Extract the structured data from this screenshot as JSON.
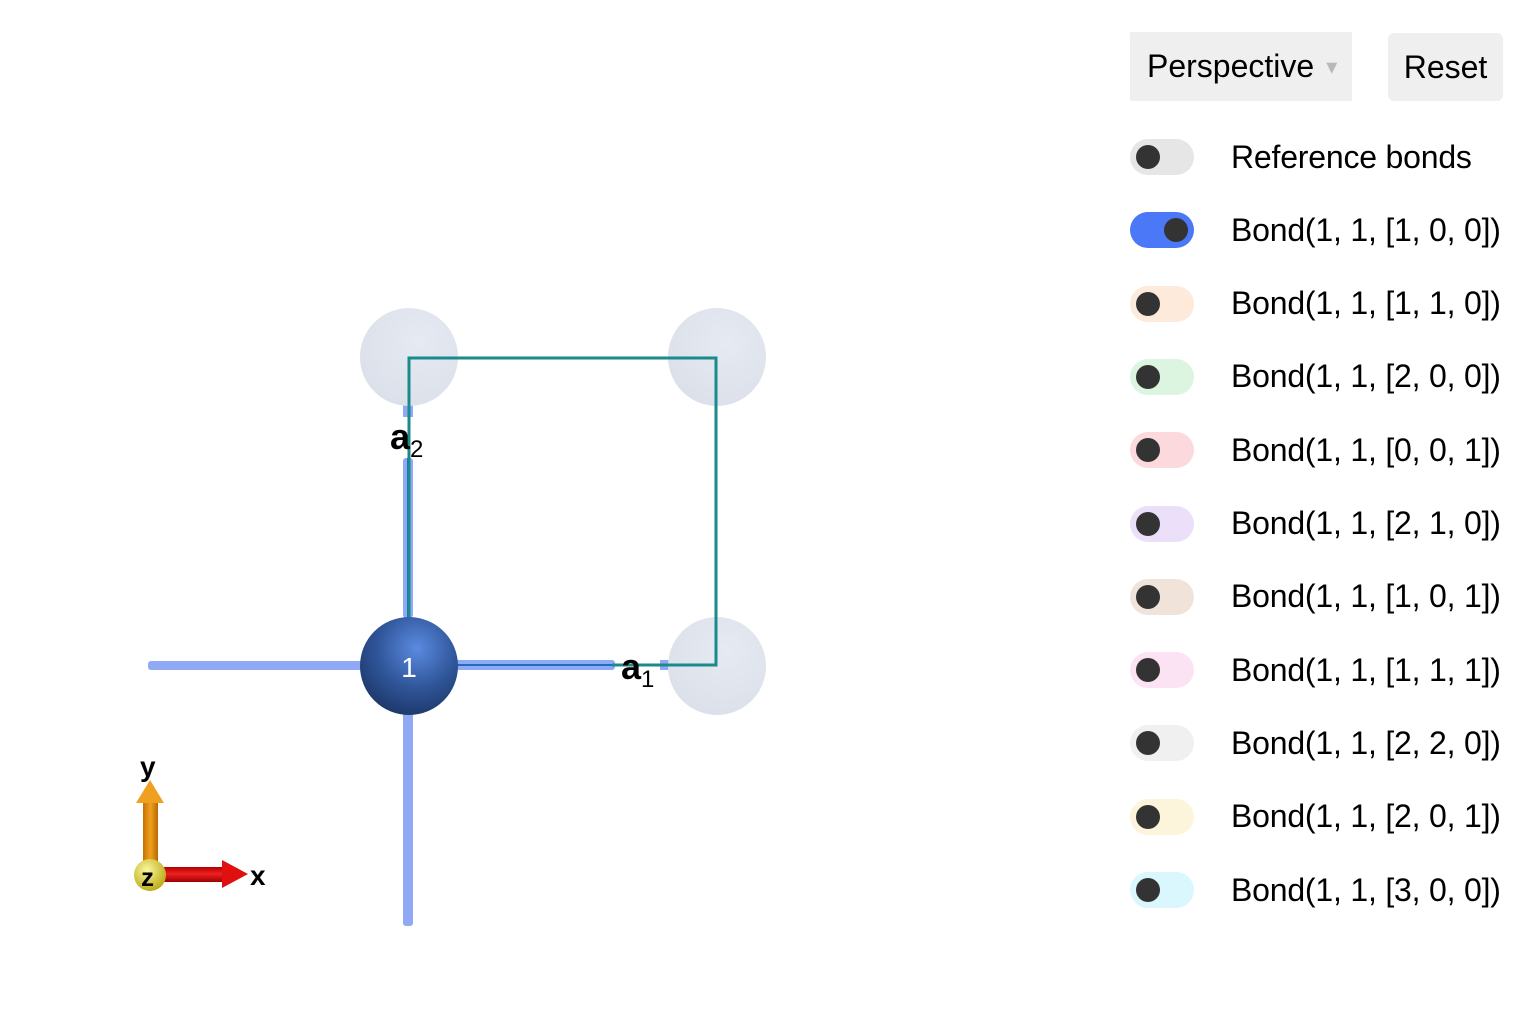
{
  "controls": {
    "projection": {
      "selected": "Perspective",
      "caret": "▾"
    },
    "reset_label": "Reset"
  },
  "toggles": [
    {
      "label": "Reference bonds",
      "on": false,
      "color": "#e6e6e6"
    },
    {
      "label": "Bond(1, 1, [1, 0, 0])",
      "on": true,
      "color": "#4a78f7"
    },
    {
      "label": "Bond(1, 1, [1, 1, 0])",
      "on": false,
      "color": "#fdeadb"
    },
    {
      "label": "Bond(1, 1, [2, 0, 0])",
      "on": false,
      "color": "#dcf5e0"
    },
    {
      "label": "Bond(1, 1, [0, 0, 1])",
      "on": false,
      "color": "#fbd9dc"
    },
    {
      "label": "Bond(1, 1, [2, 1, 0])",
      "on": false,
      "color": "#ebdffa"
    },
    {
      "label": "Bond(1, 1, [1, 0, 1])",
      "on": false,
      "color": "#f0e4da"
    },
    {
      "label": "Bond(1, 1, [1, 1, 1])",
      "on": false,
      "color": "#fce3f4"
    },
    {
      "label": "Bond(1, 1, [2, 2, 0])",
      "on": false,
      "color": "#f0f0f0"
    },
    {
      "label": "Bond(1, 1, [2, 0, 1])",
      "on": false,
      "color": "#fdf4dc"
    },
    {
      "label": "Bond(1, 1, [3, 0, 0])",
      "on": false,
      "color": "#d9f7fc"
    }
  ],
  "scene": {
    "atom_label": "1",
    "lattice_vectors": [
      {
        "name": "a",
        "subscript": "1"
      },
      {
        "name": "a",
        "subscript": "2"
      }
    ],
    "axes": {
      "x": "x",
      "y": "y",
      "z": "z"
    },
    "colors": {
      "atom": "#2e5596",
      "ghost_atom": "#dfe4ee",
      "bond": "#8fa9f5",
      "cell": "#1a8a8a",
      "axis_x": "#d81010",
      "axis_y": "#e08a00",
      "axis_z": "#e0d820"
    }
  }
}
